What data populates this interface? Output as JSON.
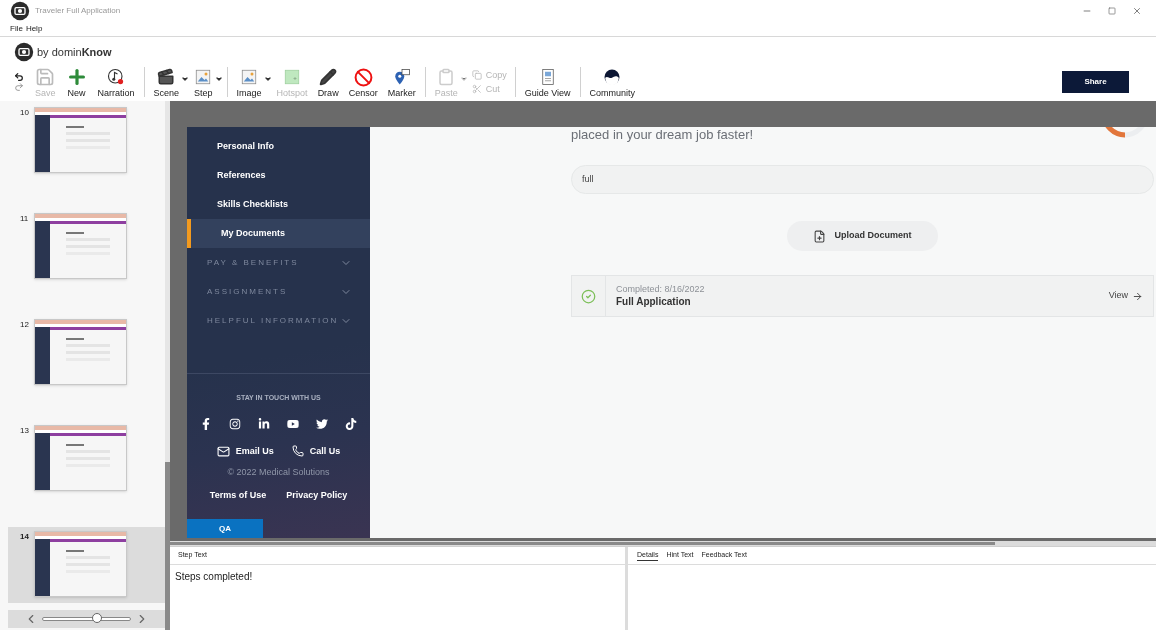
{
  "window": {
    "title": "Traveler Full Application"
  },
  "menu": [
    "File",
    "Help"
  ],
  "brand": {
    "text": "by domin**Know**"
  },
  "toolbar": [
    {
      "kind": "large",
      "label": "Save",
      "disabled": true
    },
    {
      "kind": "large",
      "label": "New",
      "disabled": false
    },
    {
      "kind": "large",
      "label": "Narration",
      "disabled": false
    },
    {
      "kind": "separator"
    },
    {
      "kind": "dropdown",
      "label": "Scene",
      "disabled": false
    },
    {
      "kind": "dropdown",
      "label": "Step",
      "disabled": false
    },
    {
      "kind": "separator"
    },
    {
      "kind": "dropdown",
      "label": "Image",
      "disabled": false
    },
    {
      "kind": "large",
      "label": "Hotspot",
      "disabled": true
    },
    {
      "kind": "large",
      "label": "Draw",
      "disabled": false
    },
    {
      "kind": "large",
      "label": "Censor",
      "disabled": false
    },
    {
      "kind": "large",
      "label": "Marker",
      "disabled": false
    },
    {
      "kind": "separator"
    },
    {
      "kind": "dropdown",
      "label": "Paste",
      "disabled": true
    },
    {
      "kind": "stack",
      "items": [
        {
          "label": "Copy",
          "disabled": true
        },
        {
          "label": "Cut",
          "disabled": true
        }
      ]
    },
    {
      "kind": "separator"
    },
    {
      "kind": "large",
      "label": "Guide View",
      "disabled": false
    },
    {
      "kind": "separator"
    },
    {
      "kind": "large",
      "label": "Community",
      "disabled": false
    }
  ],
  "share_button": "Share",
  "slides": [
    {
      "number": "10",
      "selected": false
    },
    {
      "number": "11",
      "selected": false
    },
    {
      "number": "12",
      "selected": false
    },
    {
      "number": "13",
      "selected": false
    },
    {
      "number": "14",
      "selected": true
    }
  ],
  "slide_zoom": {
    "level": 0.62
  },
  "page": {
    "nav": [
      {
        "kind": "link",
        "label": "Personal Info",
        "selected": false
      },
      {
        "kind": "link",
        "label": "References",
        "selected": false
      },
      {
        "kind": "link",
        "label": "Skills Checklists",
        "selected": false
      },
      {
        "kind": "link",
        "label": "My Documents",
        "selected": true
      },
      {
        "kind": "section",
        "label": "PAY & BENEFITS",
        "expanded": false
      },
      {
        "kind": "section",
        "label": "ASSIGNMENTS",
        "expanded": false
      },
      {
        "kind": "section",
        "label": "HELPFUL INFORMATION",
        "expanded": false
      }
    ],
    "footer": {
      "heading": "STAY IN TOUCH WITH US",
      "contacts": [
        "Email Us",
        "Call Us"
      ],
      "copyright": "© 2022 Medical Solutions",
      "links": [
        "Terms of Use",
        "Privacy Policy"
      ],
      "env_tag": "QA"
    },
    "content": {
      "intro": "placed in your dream job faster!",
      "search": {
        "value": "full"
      },
      "upload_button": "Upload Document",
      "documents": [
        {
          "status": "Completed: 8/16/2022",
          "name": "Full Application",
          "completed": true,
          "action": "View"
        }
      ]
    }
  },
  "step_text": {
    "title": "Step Text",
    "value": "Steps completed!"
  },
  "detail_tabs": [
    {
      "label": "Details",
      "selected": true
    },
    {
      "label": "Hint Text",
      "selected": false
    },
    {
      "label": "Feedback Text",
      "selected": false
    }
  ]
}
